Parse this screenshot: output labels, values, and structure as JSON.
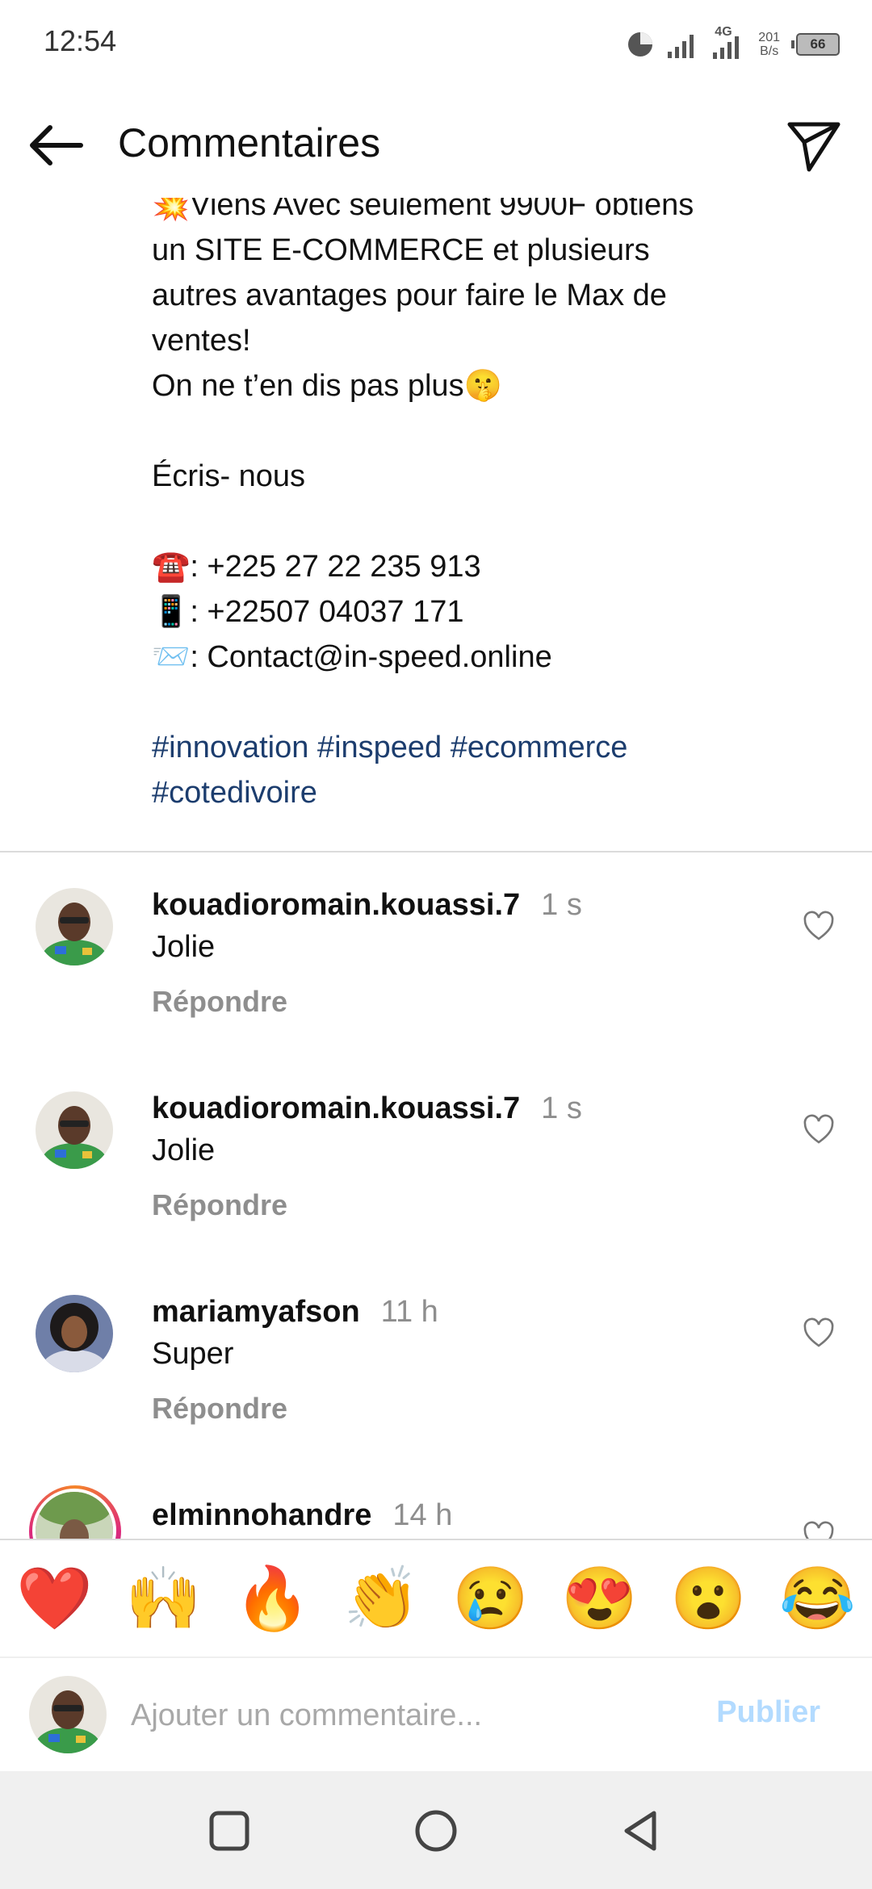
{
  "status_bar": {
    "time": "12:54",
    "network": "4G",
    "speed_value": "201",
    "speed_unit": "B/s",
    "battery": "66"
  },
  "header": {
    "title": "Commentaires"
  },
  "caption": {
    "lines": [
      "💥Viens Avec seulement 9900F obtiens",
      "un SITE E-COMMERCE et plusieurs",
      "autres avantages pour faire le Max de",
      "ventes!",
      "On ne t’en dis pas plus🤫",
      "",
      "Écris- nous",
      "",
      "☎️: +225 27 22 235 913",
      "📱: +22507 04037 171",
      "📨: Contact@in-speed.online",
      ""
    ],
    "hashtags": [
      "#innovation #inspeed #ecommerce",
      "#cotedivoire"
    ]
  },
  "comments": [
    {
      "username": "kouadioromain.kouassi.7",
      "time": "1 s",
      "text": "Jolie",
      "reply": "Répondre"
    },
    {
      "username": "kouadioromain.kouassi.7",
      "time": "1 s",
      "text": "Jolie",
      "reply": "Répondre"
    },
    {
      "username": "mariamyafson",
      "time": "11 h",
      "text": "Super",
      "reply": "Répondre"
    },
    {
      "username": "elminnohandre",
      "time": "14 h",
      "text": "",
      "reply": ""
    }
  ],
  "reactions": [
    "❤️",
    "🙌",
    "🔥",
    "👏",
    "😢",
    "😍",
    "😮",
    "😂"
  ],
  "composer": {
    "placeholder": "Ajouter un commentaire...",
    "publish_label": "Publier"
  },
  "colors": {
    "hashtag": "#1c3d6e",
    "muted": "#8e8e8e",
    "publish_disabled": "#b3dbff"
  }
}
